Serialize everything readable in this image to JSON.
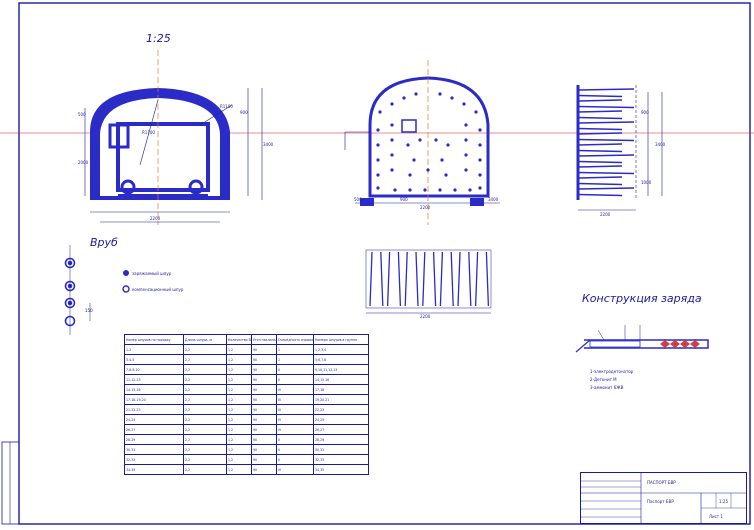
{
  "scale_label": "1:25",
  "section_labels": {
    "vrub": "Вруб",
    "charge_construction": "Конструкция заряда"
  },
  "legend": {
    "loaded": "заряжаемый шпур",
    "compensation": "компенсационный шпур"
  },
  "charge_notes": [
    "1-электродетонатор",
    "2-Детонит М",
    "3-аммонит 6ЖВ"
  ],
  "dimensions": {
    "left_width": "2200",
    "left_height": "3400",
    "left_top": "900",
    "left_mid": "500",
    "left_low": "2000",
    "left_radius": "R1100",
    "left_arc": "R1100",
    "mid_width": "2200",
    "mid_side_a": "500",
    "mid_side_b": "900",
    "mid_height": "3400",
    "right_width": "2200",
    "right_h1": "900",
    "right_h2": "3400",
    "right_h3": "1000",
    "lower_width": "2200",
    "cut_dim": "150"
  },
  "table": {
    "header": [
      "Номер шпуров по порядку",
      "Длина шпура, м",
      "Количество ВВ в шпуре, кг",
      "Угол наклона",
      "Очерёдность взрывания",
      "Номера шпуров в группе"
    ],
    "rows": [
      [
        "1-2",
        "2,2",
        "1,2",
        "90",
        "1",
        "1,2,3,4"
      ],
      [
        "3-4-5",
        "2,2",
        "1,2",
        "90",
        "1",
        "5,6,7,8"
      ],
      [
        "7-8-9-10",
        "2,2",
        "1,2",
        "90",
        "II",
        "9,10,11,12,13"
      ],
      [
        "11-12-13",
        "2,2",
        "1,2",
        "90",
        "II",
        "14,15,16"
      ],
      [
        "14-15-16",
        "2,2",
        "1,2",
        "90",
        "III",
        "17,18"
      ],
      [
        "17-18-19-20",
        "2,2",
        "1,2",
        "90",
        "III",
        "19,20,21"
      ],
      [
        "21-22-23",
        "2,2",
        "1,2",
        "90",
        "IV",
        "22,23"
      ],
      [
        "24-25",
        "2,2",
        "1,2",
        "90",
        "IV",
        "24,25"
      ],
      [
        "26-27",
        "2,2",
        "1,2",
        "90",
        "IV",
        "26,27"
      ],
      [
        "28-29",
        "2,2",
        "1,2",
        "90",
        "V",
        "28,29"
      ],
      [
        "30-31",
        "2,2",
        "1,2",
        "90",
        "V",
        "30,31"
      ],
      [
        "32-33",
        "2,2",
        "1,2",
        "90",
        "V",
        "32,33"
      ],
      [
        "34-35",
        "2,2",
        "1,2",
        "90",
        "VI",
        "34,35"
      ]
    ]
  },
  "stamp": {
    "title": "ПАСПОРТ БВР",
    "subtitle": "Паспорт БВР",
    "scale": "1:25",
    "sheet": "Лист 1"
  },
  "colors": {
    "ink": "#1a1aa0",
    "fill": "#2b2bc8",
    "axis": "#e08020",
    "ref": "#d02020"
  }
}
